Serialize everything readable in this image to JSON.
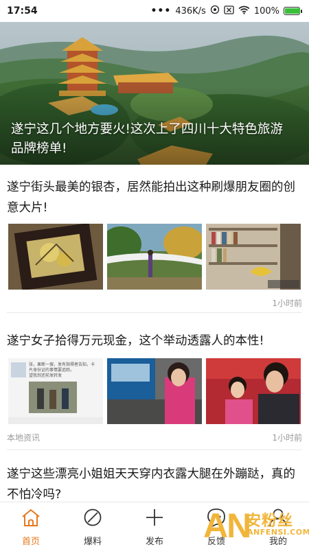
{
  "status_bar": {
    "time": "17:54",
    "dots": "•••",
    "network_speed": "436K/s",
    "battery_percent": "100%"
  },
  "hero": {
    "title": "遂宁这几个地方要火!这次上了四川十大特色旅游品牌榜单!"
  },
  "articles": [
    {
      "title": "遂宁街头最美的银杏，居然能拍出这种刷爆朋友圈的创意大片!",
      "source": "",
      "time": "1小时前"
    },
    {
      "title": "遂宁女子拾得万元现金，这个举动透露人的本性!",
      "source": "本地资讯",
      "time": "1小时前",
      "thumb_text_lines": [
        "张，果断一搜，发有指得者告知，卡",
        "片身份证的事情要追踪。",
        "望我到还前发转发"
      ]
    },
    {
      "title": "遂宁这些漂亮小姐姐天天穿内衣露大腿在外蹦跶，真的不怕冷吗?"
    }
  ],
  "bottom_nav": [
    {
      "label": "首页",
      "icon": "home-icon",
      "active": true
    },
    {
      "label": "爆料",
      "icon": "compass-icon",
      "active": false
    },
    {
      "label": "发布",
      "icon": "plus-icon",
      "active": false
    },
    {
      "label": "反馈",
      "icon": "chat-bubble-icon",
      "active": false
    },
    {
      "label": "我的",
      "icon": "user-icon",
      "active": false
    }
  ],
  "watermark": {
    "brand": "AN",
    "cn": "安粉丝",
    "url": "ANFENSI.COM"
  },
  "colors": {
    "accent": "#e8781e",
    "muted_text": "#9a9a9a",
    "divider": "#e8e8e8"
  }
}
